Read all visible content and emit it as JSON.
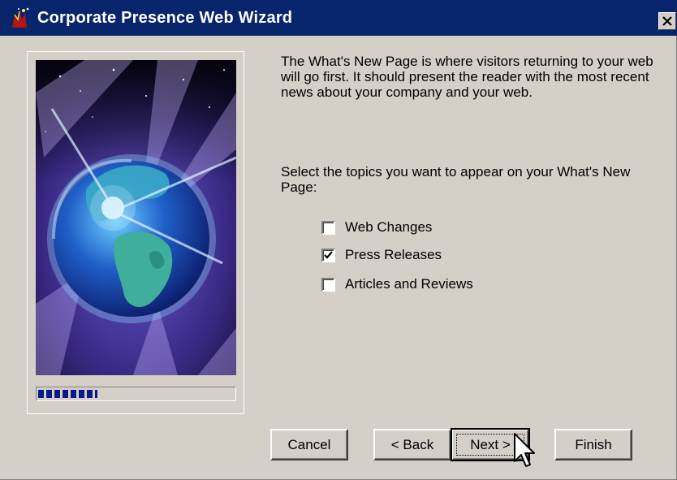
{
  "window": {
    "title": "Corporate Presence Web Wizard",
    "close_icon": "close-icon",
    "app_icon": "frontpage-wizard-icon"
  },
  "illustration": {
    "description_icon": "globe-illustration",
    "progress_fraction": 0.3
  },
  "content": {
    "description": "The What's New Page is where visitors returning to your web will go first. It should present the reader with the most recent news about your company and your web.",
    "prompt": "Select the topics you want to appear on your What's New Page:",
    "topics": [
      {
        "label": "Web Changes",
        "checked": false
      },
      {
        "label": "Press Releases",
        "checked": true
      },
      {
        "label": "Articles and Reviews",
        "checked": false
      }
    ]
  },
  "buttons": {
    "cancel": "Cancel",
    "back": "< Back",
    "next": "Next >",
    "finish": "Finish"
  },
  "colors": {
    "titlebar": "#08246b",
    "dialog_face": "#d4d0c8",
    "progress": "#0a1a8c"
  }
}
